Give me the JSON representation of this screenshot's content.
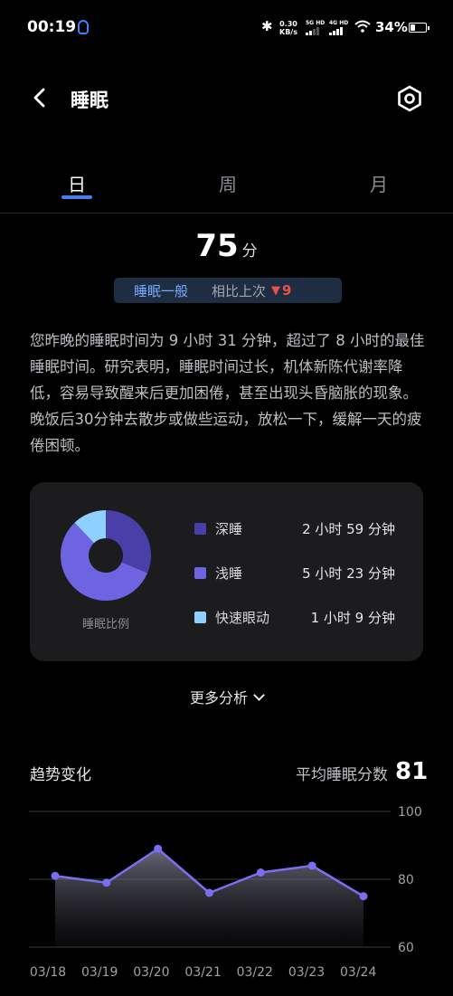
{
  "status_bar": {
    "time": "00:19",
    "net_speed": "0.30",
    "net_unit": "KB/s",
    "sim1": "5G HD",
    "sim2": "4G HD",
    "battery": "34%",
    "battery_level": 0.34
  },
  "header": {
    "title": "睡眠",
    "back_icon": "chevron-left-icon",
    "settings_icon": "settings-hex-icon"
  },
  "tabs": [
    {
      "label": "日",
      "active": true
    },
    {
      "label": "周",
      "active": false
    },
    {
      "label": "月",
      "active": false
    }
  ],
  "score": {
    "value": "75",
    "unit": "分",
    "level": "睡眠一般",
    "compare_label": "相比上次",
    "compare_diff": "9",
    "compare_direction": "down"
  },
  "description": "您昨晚的睡眠时间为 9 小时 31 分钟，超过了 8 小时的最佳睡眠时间。研究表明，睡眠时间过长，机体新陈代谢率降低，容易导致醒来后更加困倦，甚至出现头昏脑胀的现象。晚饭后30分钟去散步或做些运动，放松一下，缓解一天的疲倦困顿。",
  "breakdown": {
    "caption": "睡眠比例",
    "items": [
      {
        "name": "深睡",
        "duration": "2 小时 59 分钟",
        "minutes": 179,
        "color": "#4a3fa8"
      },
      {
        "name": "浅睡",
        "duration": "5 小时 23 分钟",
        "minutes": 323,
        "color": "#6e63e0"
      },
      {
        "name": "快速眼动",
        "duration": "1 小时 9 分钟",
        "minutes": 69,
        "color": "#8ed0ff"
      }
    ]
  },
  "more_analysis": "更多分析",
  "trend": {
    "title": "趋势变化",
    "avg_label": "平均睡眠分数",
    "avg_value": "81"
  },
  "chart_data": {
    "type": "area",
    "x": [
      "03/18",
      "03/19",
      "03/20",
      "03/21",
      "03/22",
      "03/23",
      "03/24"
    ],
    "values": [
      81,
      79,
      89,
      76,
      82,
      84,
      75
    ],
    "ylim": [
      60,
      100
    ],
    "yticks": [
      "100",
      "80",
      "60"
    ],
    "grid": true,
    "line_color": "#7a6ff0"
  }
}
